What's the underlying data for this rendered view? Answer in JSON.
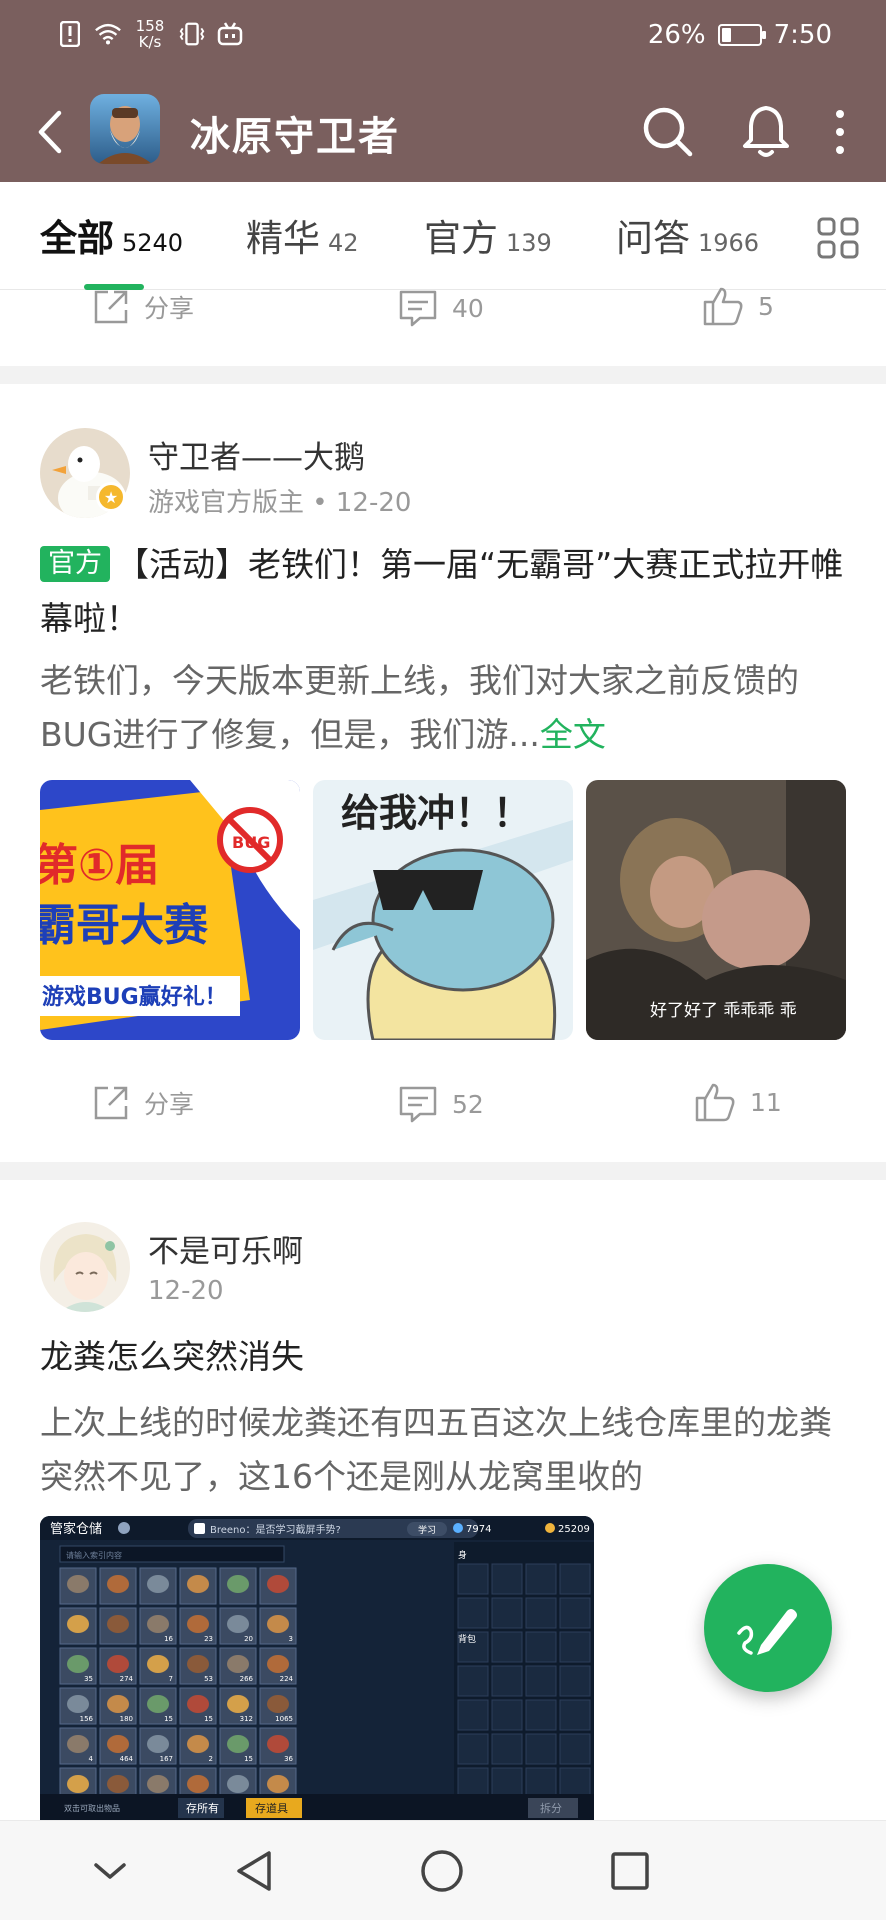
{
  "status_bar": {
    "speed_value": "158",
    "speed_unit": "K/s",
    "battery_percent": "26%",
    "battery_level": 0.26,
    "time": "7:50"
  },
  "header": {
    "title": "冰原守卫者",
    "icons": [
      "back-icon",
      "search-icon",
      "bell-icon",
      "more-icon"
    ]
  },
  "tabs": [
    {
      "label": "全部",
      "count": "5240",
      "active": true
    },
    {
      "label": "精华",
      "count": "42",
      "active": false
    },
    {
      "label": "官方",
      "count": "139",
      "active": false
    },
    {
      "label": "问答",
      "count": "1966",
      "active": false
    }
  ],
  "prev_post": {
    "share_label": "分享",
    "comments": "40",
    "likes": "5"
  },
  "post1": {
    "author": "守卫者——大鹅",
    "role": "游戏官方版主",
    "date": "12-20",
    "tag": "官方",
    "title": "【活动】老铁们！第一届“无霸哥”大赛正式拉开帷幕啦！",
    "excerpt": "老铁们，今天版本更新上线，我们对大家之前反馈的BUG进行了修复，但是，我们游...",
    "read_more": "全文",
    "images": {
      "img1_lines": [
        "第①届",
        "霸哥大赛",
        "游戏BUG赢好礼！"
      ],
      "img1_stamp": "BUG",
      "img2_text": "给我冲！！",
      "img3_caption": "好了好了  乖乖乖  乖"
    },
    "share_label": "分享",
    "comments": "52",
    "likes": "11"
  },
  "post2": {
    "author": "不是可乐啊",
    "date": "12-20",
    "title": "龙粪怎么突然消失",
    "excerpt": "上次上线的时候龙粪还有四五百这次上线仓库里的龙粪突然不见了，这16个还是刚从龙窝里收的",
    "screenshot": {
      "title": "管家仓储",
      "search_placeholder": "请输入索引内容",
      "banner": "Breeno：是否学习截屏手势?",
      "banner_btn": "学习",
      "currency1": "7974",
      "currency2": "25209",
      "side_label1": "身",
      "side_label2": "背包",
      "bottom_hint": "双击可取出物品",
      "btn_store_all": "存所有",
      "btn_store_item": "存道具",
      "btn_split": "拆分",
      "counts": [
        "",
        "",
        "",
        "",
        "",
        "",
        "",
        "",
        "16",
        "23",
        "20",
        "3",
        "35",
        "274",
        "7",
        "53",
        "266",
        "224",
        "156",
        "180",
        "15",
        "15",
        "312",
        "1065",
        "4",
        "464",
        "167",
        "2",
        "15",
        "36"
      ]
    }
  },
  "fab": {
    "icon": "edit-pen-icon"
  },
  "nav": {
    "icons": [
      "collapse-icon",
      "back-triangle-icon",
      "home-circle-icon",
      "recents-square-icon"
    ]
  },
  "colors": {
    "header_bg": "#7a5f5e",
    "accent": "#22b35e"
  }
}
